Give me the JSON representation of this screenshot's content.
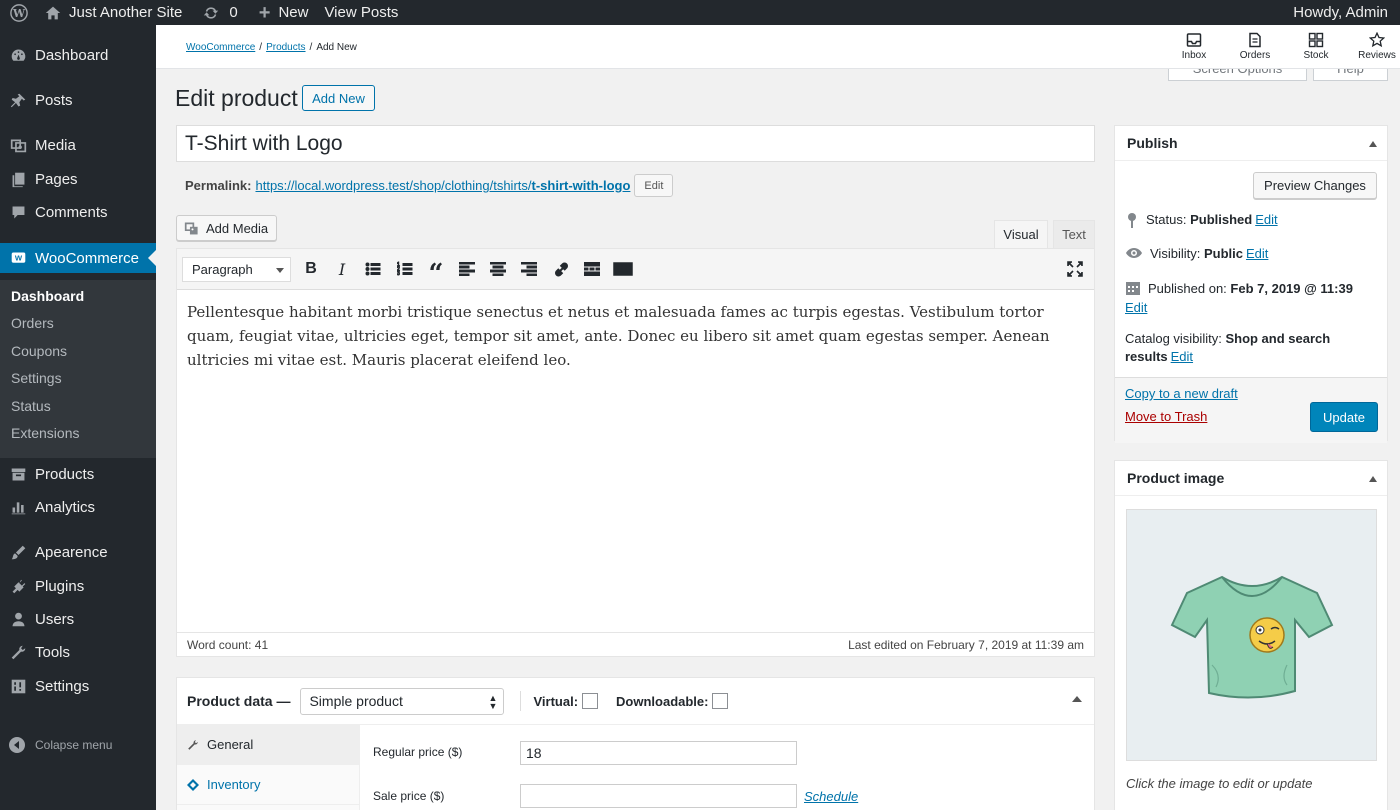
{
  "adminbar": {
    "site_name": "Just Another Site",
    "updates_count": "0",
    "new_label": "New",
    "view_posts_label": "View Posts",
    "greeting": "Howdy, Admin"
  },
  "sidebar": {
    "items": [
      {
        "label": "Dashboard",
        "icon": "dashboard-icon"
      },
      {
        "label": "Posts",
        "icon": "pin-icon"
      },
      {
        "label": "Media",
        "icon": "media-icon"
      },
      {
        "label": "Pages",
        "icon": "pages-icon"
      },
      {
        "label": "Comments",
        "icon": "comments-icon"
      },
      {
        "label": "WooCommerce",
        "icon": "woocommerce-icon"
      },
      {
        "label": "Products",
        "icon": "archive-icon"
      },
      {
        "label": "Analytics",
        "icon": "chart-icon"
      },
      {
        "label": "Apearence",
        "icon": "brush-icon"
      },
      {
        "label": "Plugins",
        "icon": "plugin-icon"
      },
      {
        "label": "Users",
        "icon": "users-icon"
      },
      {
        "label": "Tools",
        "icon": "wrench-icon"
      },
      {
        "label": "Settings",
        "icon": "settings-icon"
      }
    ],
    "submenu": [
      "Dashboard",
      "Orders",
      "Coupons",
      "Settings",
      "Status",
      "Extensions"
    ],
    "collapse_label": "Colapse menu"
  },
  "header": {
    "breadcrumb": [
      "WooCommerce",
      "Products",
      "Add New"
    ],
    "activity": [
      "Inbox",
      "Orders",
      "Stock",
      "Reviews"
    ],
    "screen_options": "Screen Options",
    "help": "Help"
  },
  "page": {
    "title": "Edit product",
    "add_new": "Add New",
    "product_title": "T-Shirt with Logo",
    "permalink_label": "Permalink:",
    "permalink_base": "https://local.wordpress.test/shop/clothing/tshirts/",
    "permalink_slug": "t-shirt-with-logo",
    "permalink_edit": "Edit"
  },
  "editor": {
    "add_media": "Add Media",
    "tab_visual": "Visual",
    "tab_text": "Text",
    "format": "Paragraph",
    "content": "Pellentesque habitant morbi tristique senectus et netus et malesuada fames ac turpis egestas. Vestibulum tortor quam, feugiat vitae, ultricies eget, tempor sit amet, ante. Donec eu libero sit amet quam egestas semper. Aenean ultricies mi vitae est. Mauris placerat eleifend leo.",
    "word_count": "Word count: 41",
    "last_edited": "Last edited on February 7, 2019 at 11:39 am"
  },
  "product_data": {
    "title": "Product data —",
    "type": "Simple product",
    "virtual_label": "Virtual:",
    "downloadable_label": "Downloadable:",
    "tabs": [
      "General",
      "Inventory"
    ],
    "regular_price_label": "Regular price ($)",
    "regular_price_value": "18",
    "sale_price_label": "Sale price ($)",
    "sale_price_value": "",
    "schedule_label": "Schedule"
  },
  "publish": {
    "title": "Publish",
    "preview": "Preview Changes",
    "status_label": "Status:",
    "status_value": "Published",
    "visibility_label": "Visibility:",
    "visibility_value": "Public",
    "published_label": "Published on:",
    "published_value": "Feb 7, 2019 @ 11:39",
    "catalog_label": "Catalog visibility:",
    "catalog_value": "Shop and search results",
    "edit": "Edit",
    "copy_draft": "Copy to a new draft",
    "trash": "Move to Trash",
    "update": "Update"
  },
  "product_image": {
    "title": "Product image",
    "caption": "Click the image to edit or update"
  },
  "colors": {
    "admin_dark": "#23282d",
    "accent": "#0073aa",
    "primary_button": "#0085ba"
  }
}
